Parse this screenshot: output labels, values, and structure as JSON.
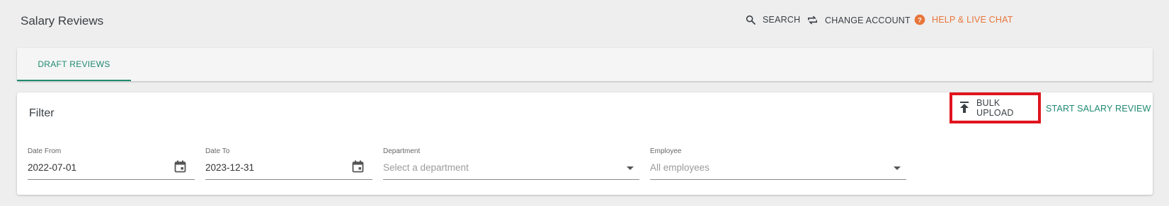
{
  "page": {
    "title": "Salary Reviews"
  },
  "topnav": {
    "search": "SEARCH",
    "change_account": "CHANGE ACCOUNT",
    "help": "HELP & LIVE CHAT"
  },
  "tabs": [
    {
      "label": "DRAFT REVIEWS",
      "active": true
    }
  ],
  "filter": {
    "title": "Filter",
    "bulk_upload": "BULK UPLOAD",
    "start_review": "START SALARY REVIEW",
    "date_from": {
      "label": "Date From",
      "value": "2022-07-01"
    },
    "date_to": {
      "label": "Date To",
      "value": "2023-12-31"
    },
    "department": {
      "label": "Department",
      "placeholder": "Select a department"
    },
    "employee": {
      "label": "Employee",
      "placeholder": "All employees"
    }
  },
  "colors": {
    "accent": "#1f8a6f",
    "help": "#e8753a",
    "highlight": "#e0141e"
  }
}
